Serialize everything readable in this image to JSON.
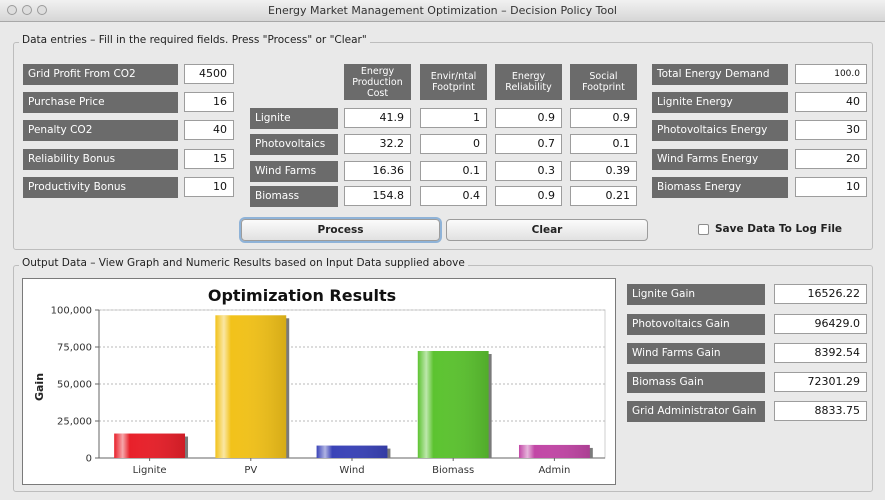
{
  "window": {
    "title": "Energy Market Management Optimization – Decision Policy Tool"
  },
  "input_group": {
    "legend": "Data entries – Fill in the required fields. Press \"Process\" or \"Clear\""
  },
  "params": [
    {
      "label": "Grid Profit From CO2",
      "value": "4500"
    },
    {
      "label": "Purchase Price",
      "value": "16"
    },
    {
      "label": "Penalty CO2",
      "value": "40"
    },
    {
      "label": "Reliability Bonus",
      "value": "15"
    },
    {
      "label": "Productivity Bonus",
      "value": "10"
    }
  ],
  "matrix": {
    "columns": [
      "Energy Production Cost",
      "Envir/ntal Footprint",
      "Energy Reliability",
      "Social Footprint"
    ],
    "rows": [
      {
        "label": "Lignite",
        "values": [
          "41.9",
          "1",
          "0.9",
          "0.9"
        ]
      },
      {
        "label": "Photovoltaics",
        "values": [
          "32.2",
          "0",
          "0.7",
          "0.1"
        ]
      },
      {
        "label": "Wind Farms",
        "values": [
          "16.36",
          "0.1",
          "0.3",
          "0.39"
        ]
      },
      {
        "label": "Biomass",
        "values": [
          "154.8",
          "0.4",
          "0.9",
          "0.21"
        ]
      }
    ]
  },
  "demand": [
    {
      "label": "Total Energy Demand",
      "value": "100.0"
    },
    {
      "label": "Lignite Energy",
      "value": "40"
    },
    {
      "label": "Photovoltaics Energy",
      "value": "30"
    },
    {
      "label": "Wind Farms Energy",
      "value": "20"
    },
    {
      "label": "Biomass Energy",
      "value": "10"
    }
  ],
  "buttons": {
    "process": "Process",
    "clear": "Clear"
  },
  "save_log": {
    "label": "Save Data To Log File",
    "checked": false
  },
  "output_group": {
    "legend": "Output Data – View Graph and Numeric Results based on Input Data supplied above"
  },
  "results": [
    {
      "label": "Lignite Gain",
      "value": "16526.22"
    },
    {
      "label": "Photovoltaics Gain",
      "value": "96429.0"
    },
    {
      "label": "Wind Farms Gain",
      "value": "8392.54"
    },
    {
      "label": "Biomass Gain",
      "value": "72301.29"
    },
    {
      "label": "Grid Administrator Gain",
      "value": "8833.75"
    }
  ],
  "chart_data": {
    "type": "bar",
    "title": "Optimization Results",
    "xlabel": "",
    "ylabel": "Gain",
    "categories": [
      "Lignite",
      "PV",
      "Wind",
      "Biomass",
      "Admin"
    ],
    "values": [
      16526.22,
      96429.0,
      8392.54,
      72301.29,
      8833.75
    ],
    "colors": [
      "#e8202a",
      "#f2c21a",
      "#3a43b8",
      "#5cc330",
      "#c247a6"
    ],
    "ylim": [
      0,
      100000
    ],
    "yticks": [
      0,
      25000,
      50000,
      75000,
      100000
    ],
    "ytick_labels": [
      "0",
      "25,000",
      "50,000",
      "75,000",
      "100,000"
    ],
    "grid": true,
    "legend": false
  }
}
